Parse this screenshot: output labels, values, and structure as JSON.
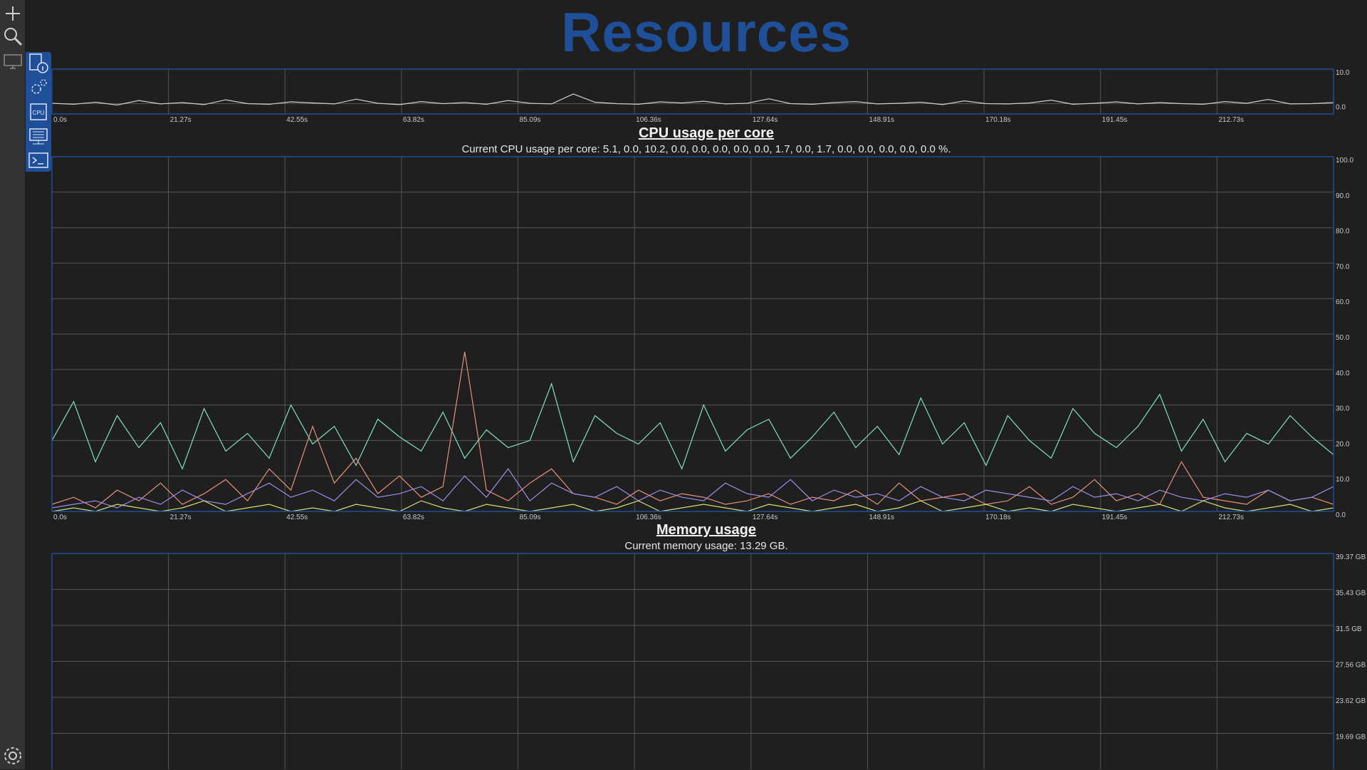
{
  "page": {
    "title": "Resources"
  },
  "sidebar": {
    "items": [
      {
        "name": "add-icon"
      },
      {
        "name": "search-icon"
      },
      {
        "name": "monitor-icon"
      },
      {
        "name": "settings-icon"
      }
    ]
  },
  "subbar": {
    "items": [
      {
        "name": "storage-info-icon"
      },
      {
        "name": "processes-gears-icon"
      },
      {
        "name": "cpu-icon",
        "label": "CPU"
      },
      {
        "name": "network-icon"
      },
      {
        "name": "terminal-icon"
      }
    ]
  },
  "colors": {
    "accent": "#1f4f99",
    "background": "#1f1f1f",
    "sidebar": "#333333",
    "grid": "#555555",
    "axis": "#1f4f99",
    "series": [
      "#7fe0c8",
      "#e8907a",
      "#9a8ee8",
      "#d1e07a",
      "#e07ad1",
      "#7ab8e0",
      "#6fe06f",
      "#e0b87a"
    ]
  },
  "x_ticks": [
    "0.0s",
    "21.27s",
    "42.55s",
    "63.82s",
    "85.09s",
    "106.36s",
    "127.64s",
    "148.91s",
    "170.18s",
    "191.45s",
    "212.73s"
  ],
  "sections": {
    "cpu_total": {
      "y_ticks": [
        "10.0",
        "0.0"
      ]
    },
    "cpu_per_core": {
      "title": "CPU usage per core",
      "subtitle": "Current CPU usage per core: 5.1, 0.0, 10.2, 0.0, 0.0, 0.0, 0.0, 0.0, 1.7, 0.0, 1.7, 0.0, 0.0, 0.0, 0.0, 0.0 %.",
      "y_ticks": [
        "100.0",
        "90.0",
        "80.0",
        "70.0",
        "60.0",
        "50.0",
        "40.0",
        "30.0",
        "20.0",
        "10.0",
        "0.0"
      ]
    },
    "memory": {
      "title": "Memory usage",
      "subtitle": "Current memory usage: 13.29 GB.",
      "y_ticks": [
        "39.37 GB",
        "35.43 GB",
        "31.5 GB",
        "27.56 GB",
        "23.62 GB",
        "19.69 GB"
      ]
    }
  },
  "chart_data": [
    {
      "type": "line",
      "xlabel": "",
      "ylabel": "",
      "x_range_s": [
        0,
        230
      ],
      "ylim": [
        0,
        10
      ],
      "series": [
        {
          "values": [
            3.1,
            2.8,
            3.4,
            2.6,
            3.9,
            2.9,
            3.3,
            2.7,
            4.1,
            3.0,
            2.8,
            3.5,
            3.2,
            2.9,
            4.3,
            3.1,
            2.7,
            3.6,
            3.0,
            3.3,
            2.8,
            3.9,
            3.1,
            2.9,
            5.8,
            3.4,
            3.0,
            2.8,
            3.5,
            3.2,
            3.7,
            2.9,
            3.1,
            4.4,
            3.0,
            2.8,
            3.3,
            3.6,
            2.9,
            3.1,
            3.4,
            2.7,
            3.8,
            3.0,
            2.9,
            3.2,
            4.0,
            2.8,
            3.1,
            3.5,
            2.9,
            3.3,
            3.0,
            2.8,
            3.6,
            3.1,
            4.2,
            2.9,
            3.0,
            3.3
          ]
        }
      ]
    },
    {
      "type": "line",
      "title": "CPU usage per core",
      "xlabel": "",
      "ylabel": "",
      "x_range_s": [
        0,
        230
      ],
      "ylim": [
        0,
        100
      ],
      "series": [
        {
          "values": [
            20,
            31,
            14,
            27,
            18,
            25,
            12,
            29,
            17,
            22,
            15,
            30,
            19,
            24,
            13,
            26,
            21,
            17,
            28,
            15,
            23,
            18,
            20,
            36,
            14,
            27,
            22,
            19,
            25,
            12,
            30,
            17,
            23,
            26,
            15,
            21,
            28,
            18,
            24,
            16,
            32,
            19,
            25,
            13,
            27,
            20,
            15,
            29,
            22,
            18,
            24,
            33,
            17,
            26,
            14,
            22,
            19,
            27,
            21,
            16
          ]
        },
        {
          "values": [
            2,
            4,
            1,
            6,
            3,
            8,
            2,
            5,
            9,
            3,
            12,
            6,
            24,
            8,
            15,
            5,
            10,
            4,
            7,
            45,
            6,
            3,
            8,
            12,
            5,
            4,
            2,
            6,
            3,
            5,
            4,
            2,
            3,
            5,
            2,
            4,
            3,
            6,
            2,
            8,
            3,
            4,
            5,
            2,
            3,
            7,
            2,
            4,
            9,
            3,
            5,
            2,
            14,
            4,
            3,
            2,
            6,
            3,
            4,
            2
          ]
        },
        {
          "values": [
            1,
            2,
            3,
            1,
            4,
            2,
            6,
            3,
            2,
            5,
            8,
            4,
            6,
            3,
            9,
            4,
            5,
            7,
            3,
            10,
            4,
            12,
            3,
            8,
            5,
            4,
            7,
            3,
            6,
            4,
            3,
            8,
            5,
            4,
            9,
            3,
            6,
            4,
            5,
            3,
            7,
            4,
            3,
            6,
            5,
            4,
            3,
            7,
            4,
            5,
            3,
            6,
            4,
            3,
            5,
            4,
            6,
            3,
            4,
            7
          ]
        },
        {
          "values": [
            0,
            1,
            0,
            2,
            1,
            0,
            1,
            3,
            0,
            1,
            2,
            0,
            1,
            0,
            2,
            1,
            0,
            3,
            1,
            0,
            2,
            1,
            0,
            1,
            2,
            0,
            1,
            3,
            0,
            1,
            2,
            1,
            0,
            2,
            1,
            0,
            1,
            2,
            0,
            1,
            3,
            0,
            1,
            2,
            0,
            1,
            0,
            2,
            1,
            0,
            1,
            2,
            0,
            3,
            1,
            0,
            1,
            2,
            0,
            1
          ]
        }
      ]
    },
    {
      "type": "line",
      "title": "Memory usage",
      "xlabel": "",
      "ylabel": "",
      "x_range_s": [
        0,
        230
      ],
      "y_ticks_visible": [
        39.37,
        35.43,
        31.5,
        27.56,
        23.62,
        19.69
      ],
      "series": []
    }
  ]
}
